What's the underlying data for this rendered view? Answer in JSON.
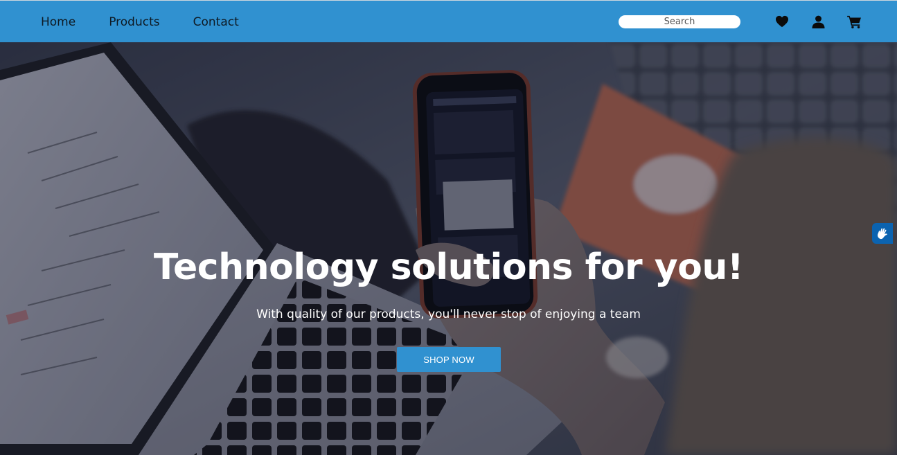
{
  "nav": {
    "links": [
      {
        "label": "Home"
      },
      {
        "label": "Products"
      },
      {
        "label": "Contact"
      }
    ],
    "search_placeholder": "Search",
    "icons": [
      "heart-icon",
      "user-icon",
      "cart-icon"
    ]
  },
  "hero": {
    "title": "Technology solutions for you!",
    "subtitle": "With quality of our products, you'll never stop of enjoying a team",
    "button_label": "SHOP NOW"
  },
  "widgets": {
    "accessibility_icon": "hand-sign-icon"
  },
  "colors": {
    "nav_bg": "#3091d0",
    "button_bg": "#3091d0",
    "text_light": "#ffffff",
    "accessibility_bg": "#0b63b0"
  }
}
